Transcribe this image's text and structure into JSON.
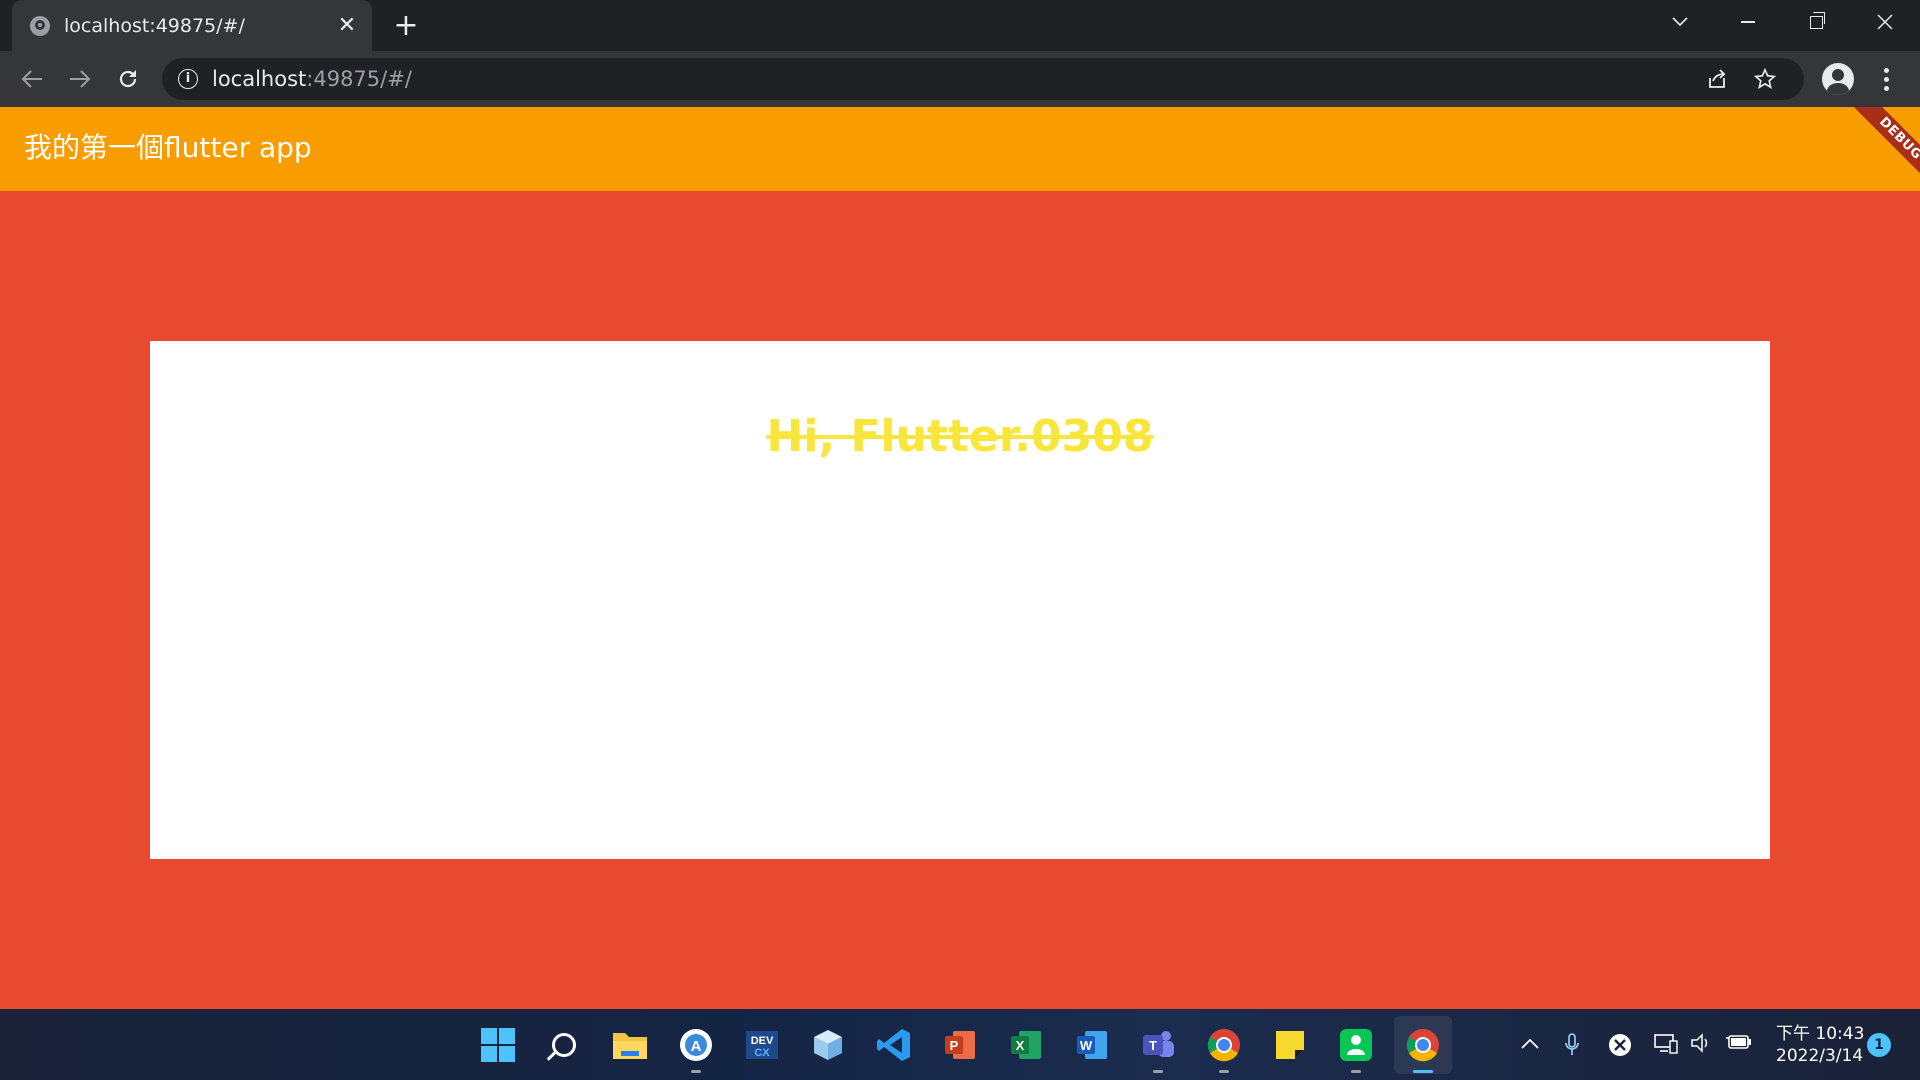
{
  "browser": {
    "tab_title": "localhost:49875/#/",
    "tab_icon": "globe-icon",
    "close_tab_glyph": "✕",
    "new_tab_glyph": "+",
    "url_host": "localhost",
    "url_rest": ":49875/#/"
  },
  "app": {
    "appbar_title": "我的第一個flutter app",
    "debug_banner": "DEBUG",
    "card_text": "Hi, Flutter.0308",
    "colors": {
      "appbar": "#f89c00",
      "body": "#e84a30",
      "card": "#ffffff",
      "text": "#f8e63a"
    }
  },
  "taskbar": {
    "apps": [
      {
        "name": "start",
        "icon": "windows-logo-icon"
      },
      {
        "name": "search",
        "icon": "search-icon"
      },
      {
        "name": "file-explorer",
        "icon": "folder-icon"
      },
      {
        "name": "android-studio",
        "icon": "android-studio-icon",
        "label": "A"
      },
      {
        "name": "devexpress",
        "icon": "dev-icon",
        "label": "DEV"
      },
      {
        "name": "3d-box",
        "icon": "box-icon"
      },
      {
        "name": "vscode",
        "icon": "vscode-icon"
      },
      {
        "name": "powerpoint",
        "icon": "powerpoint-icon",
        "label": "P"
      },
      {
        "name": "excel",
        "icon": "excel-icon",
        "label": "X"
      },
      {
        "name": "word",
        "icon": "word-icon",
        "label": "W"
      },
      {
        "name": "teams",
        "icon": "teams-icon",
        "label": "T"
      },
      {
        "name": "chrome",
        "icon": "chrome-icon"
      },
      {
        "name": "sticky-notes",
        "icon": "sticky-notes-icon"
      },
      {
        "name": "line",
        "icon": "contact-icon"
      },
      {
        "name": "chrome-active",
        "icon": "chrome-icon"
      }
    ],
    "time": "下午 10:43",
    "date": "2022/3/14",
    "notification_count": "1"
  }
}
